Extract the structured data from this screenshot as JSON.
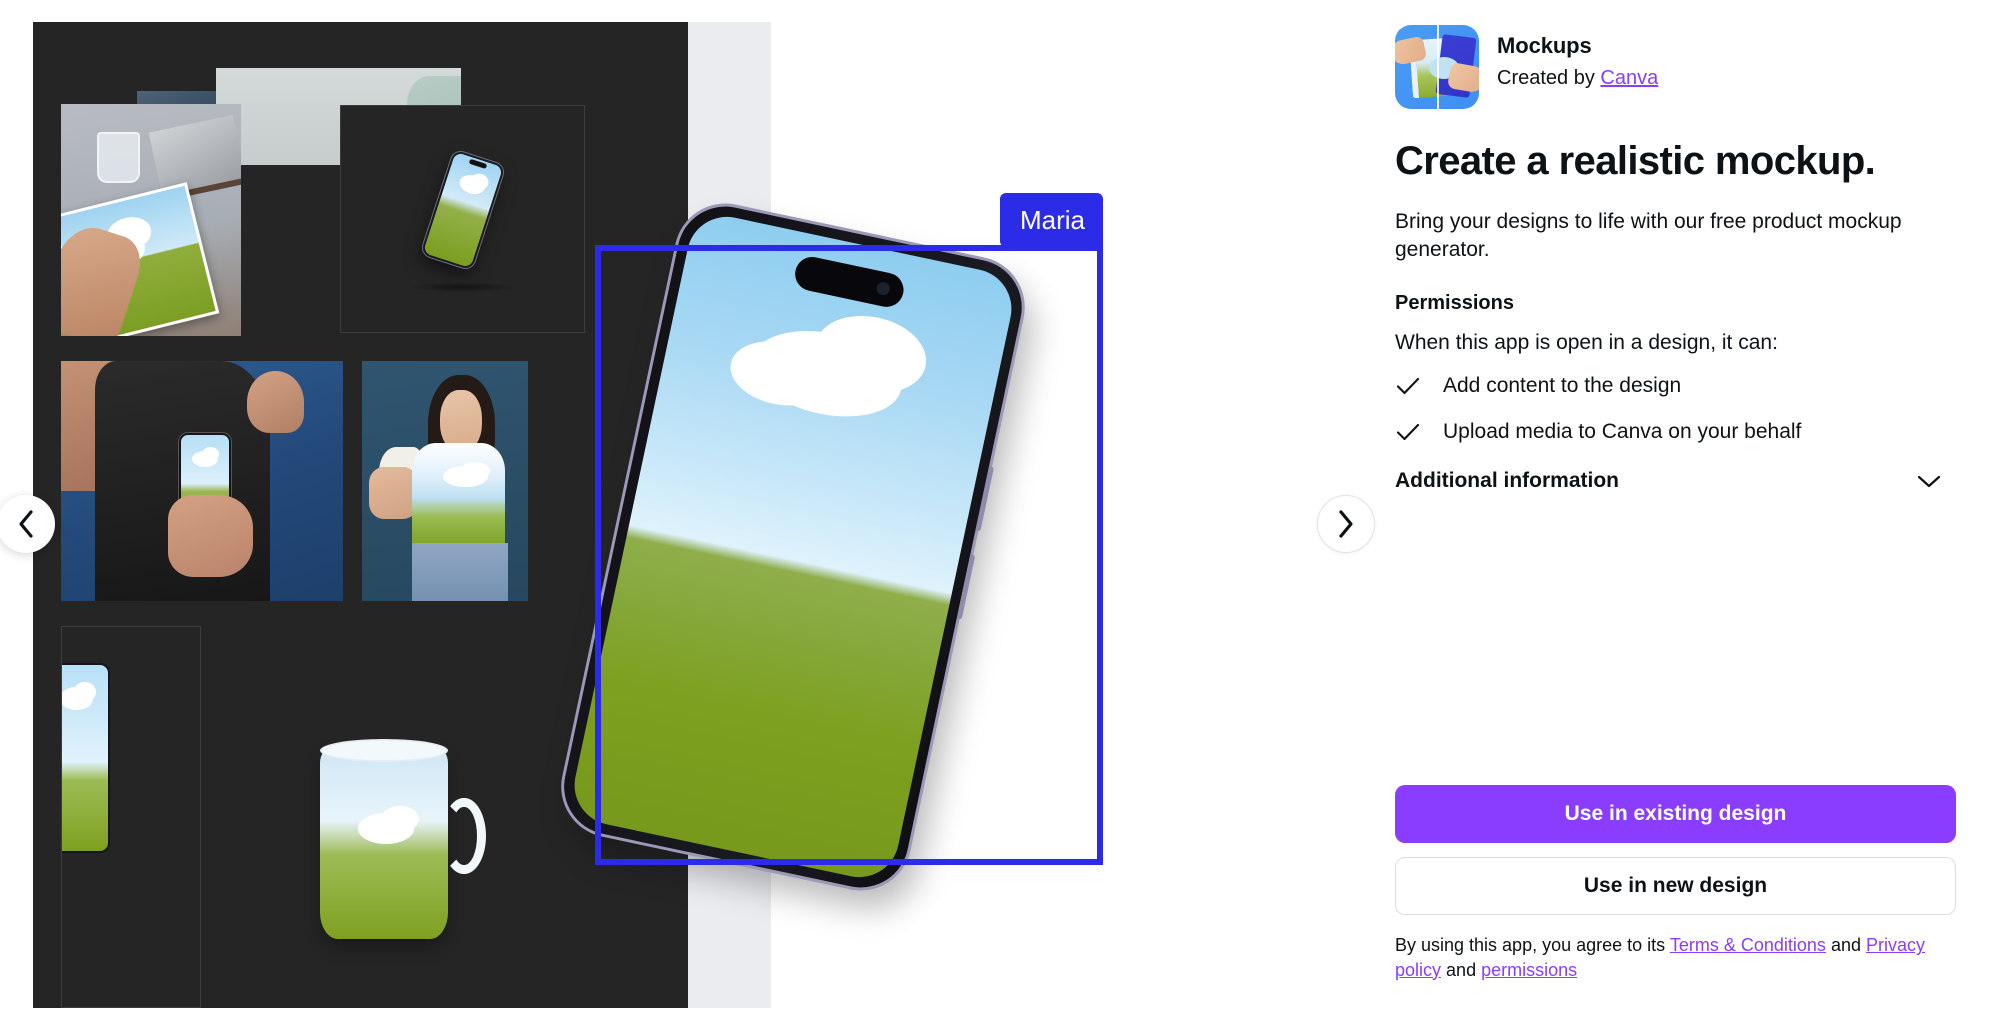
{
  "app": {
    "icon_name": "mockups-app-icon",
    "title": "Mockups",
    "created_by_prefix": "Created by",
    "author_link": "Canva"
  },
  "details": {
    "headline": "Create a realistic mockup.",
    "description": "Bring your designs to life with our free product mockup generator.",
    "permissions_title": "Permissions",
    "permissions_lead": "When this app is open in a design, it can:",
    "permissions": [
      "Add content to the design",
      "Upload media to Canva on your behalf"
    ],
    "additional_information": "Additional information"
  },
  "actions": {
    "primary_label": "Use in existing design",
    "secondary_label": "Use in new design",
    "legal_prefix": "By using this app, you agree to its",
    "legal_link_terms": "Terms & Conditions",
    "legal_and_1": "and",
    "legal_link_privacy": "Privacy policy",
    "legal_and_2": "and",
    "legal_link_permissions": "permissions"
  },
  "canvas": {
    "selection_label": "Maria",
    "prev_label": "‹",
    "next_label": "›"
  },
  "colors": {
    "accent_purple": "#8b3dff",
    "selection_blue": "#2b2be8",
    "canvas_dark": "#252525",
    "strip_gray": "#eaecef",
    "text": "#0d1216"
  }
}
